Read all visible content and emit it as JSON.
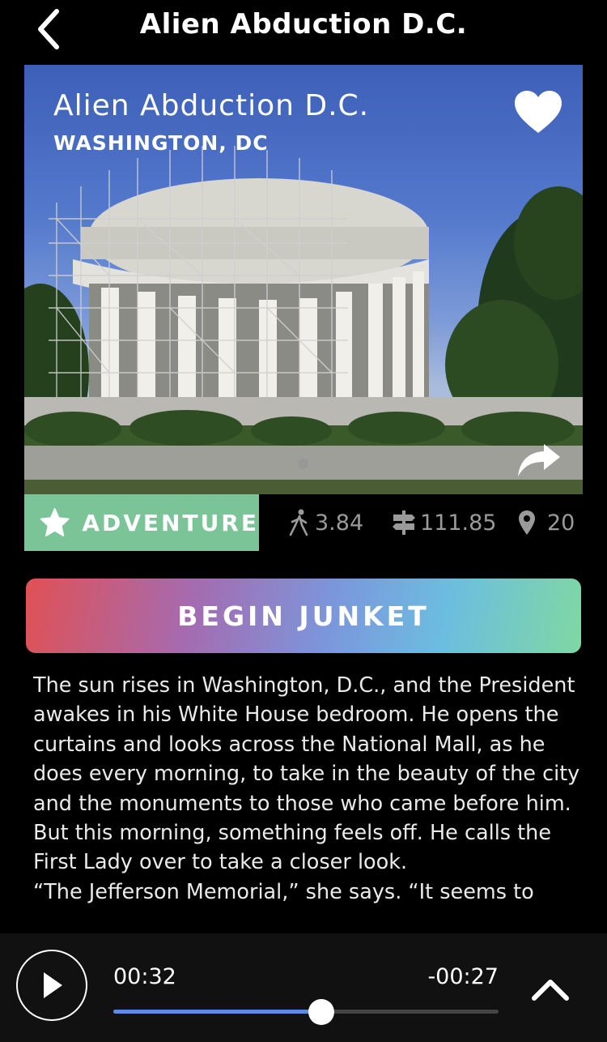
{
  "topbar": {
    "title": "Alien Abduction D.C.",
    "back_icon": "chevron-left-icon"
  },
  "hero": {
    "title": "Alien Abduction D.C.",
    "location": "WASHINGTON, DC",
    "favorite_icon": "heart-icon",
    "share_icon": "share-arrow-icon",
    "image_description_icon": "jefferson-memorial-photo",
    "page_indicator": {
      "count": 1,
      "active": 0
    }
  },
  "info": {
    "category": {
      "label": "ADVENTURE",
      "icon": "star-icon",
      "color": "#7bc497"
    },
    "stats": [
      {
        "icon": "walking-person-icon",
        "value": "3.84"
      },
      {
        "icon": "signpost-icon",
        "value": "111.85"
      },
      {
        "icon": "map-pin-icon",
        "value": "20"
      }
    ]
  },
  "cta": {
    "label": "BEGIN JUNKET",
    "gradient": [
      "#e05155",
      "#a56bb0",
      "#7b97dc",
      "#6cbde0",
      "#7fd8a2"
    ]
  },
  "story": {
    "text": "The sun rises in Washington, D.C., and the President awakes in his White House bedroom. He opens the curtains and looks across the National Mall, as he does every morning, to take in the beauty of the city and the monuments to those who came before him. But this morning, something feels off. He calls the First Lady over to take a closer look.",
    "text2": "“The Jefferson Memorial,” she says. “It seems to"
  },
  "player": {
    "play_icon": "play-icon",
    "elapsed": "00:32",
    "remaining": "-00:27",
    "progress": 0.54,
    "accent": "#5a8de0",
    "expand_icon": "chevron-up-icon"
  }
}
